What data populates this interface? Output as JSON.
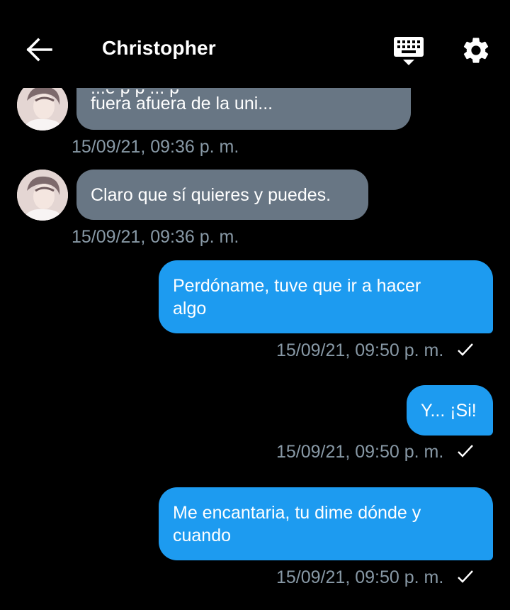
{
  "header": {
    "title": "Christopher",
    "back_icon": "back-arrow-icon",
    "keyboard_icon": "keyboard-icon",
    "settings_icon": "gear-icon"
  },
  "colors": {
    "background": "#000000",
    "incoming_bubble": "#687684",
    "outgoing_bubble": "#1d9bf0",
    "timestamp": "#8899a6"
  },
  "messages": [
    {
      "direction": "incoming",
      "partial_line": "...e   p  p    ...  p",
      "text": "fuera afuera de la uni...",
      "timestamp": "15/09/21, 09:36 p. m."
    },
    {
      "direction": "incoming",
      "text": "Claro que sí quieres y puedes.",
      "timestamp": "15/09/21, 09:36 p. m."
    },
    {
      "direction": "outgoing",
      "text_line1": "Perdóname, tuve que ir a hacer",
      "text_line2": "algo",
      "timestamp": "15/09/21, 09:50 p. m.",
      "status": "✓"
    },
    {
      "direction": "outgoing",
      "text": "Y... ¡Si!",
      "timestamp": "15/09/21, 09:50 p. m.",
      "status": "✓"
    },
    {
      "direction": "outgoing",
      "text_line1": "Me encantaria, tu dime dónde y",
      "text_line2": "cuando",
      "timestamp": "15/09/21, 09:50 p. m.",
      "status": "✓"
    }
  ]
}
